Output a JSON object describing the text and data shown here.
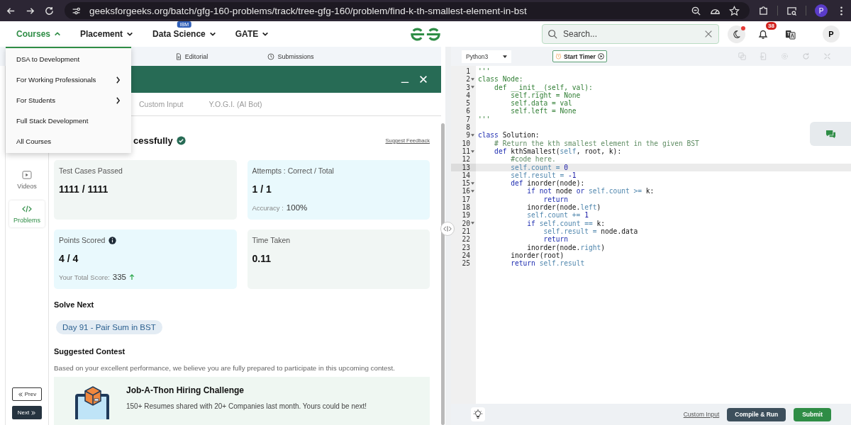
{
  "browser": {
    "url": "geeksforgeeks.org/batch/gfg-160-problems/track/tree-gfg-160/problem/find-k-th-smallest-element-in-bst",
    "profile": "P"
  },
  "nav": {
    "items": [
      {
        "label": "Courses",
        "selected": true
      },
      {
        "label": "Placement",
        "selected": false
      },
      {
        "label": "Data Science",
        "selected": false,
        "badge": "IBM"
      },
      {
        "label": "GATE",
        "selected": false
      }
    ],
    "search": {
      "placeholder": "Search..."
    },
    "theme_alert": true,
    "notifications": "38",
    "avatar": "P"
  },
  "courses_menu": [
    {
      "label": "DSA to Development",
      "submenu": false
    },
    {
      "label": "For Working Professionals",
      "submenu": true
    },
    {
      "label": "For Students",
      "submenu": true
    },
    {
      "label": "Full Stack Development",
      "submenu": false
    },
    {
      "label": "All Courses",
      "submenu": false
    }
  ],
  "problem_tabs": [
    {
      "label": "Editorial",
      "kind": "document",
      "selected": false
    },
    {
      "label": "Submissions",
      "kind": "clock",
      "selected": false
    }
  ],
  "sidebar": {
    "items": [
      {
        "label": "Videos",
        "kind": "video",
        "selected": false
      },
      {
        "label": "Problems",
        "kind": "code",
        "selected": true
      }
    ],
    "prev": "Prev",
    "next": "Next"
  },
  "result": {
    "tabs": [
      {
        "label": "Custom Input",
        "selected": false
      },
      {
        "label": "Y.O.G.I. (AI Bot)",
        "selected": false
      }
    ],
    "heading": "cessfully",
    "feedback": "Suggest Feedback",
    "cards": [
      {
        "label": "Test Cases Passed",
        "value": "1111 / 1111",
        "color": "#f1f6f4",
        "info": false
      },
      {
        "label": "Attempts : Correct / Total",
        "value": "1 / 1",
        "color": "#e9f9fd",
        "info": false,
        "sub_label": "Accuracy :",
        "sub_value": "100%",
        "trend_up": false
      },
      {
        "label": "Points Scored",
        "info": true,
        "value": "4 / 4",
        "color": "#e9f9fd",
        "sub_label": "Your Total Score:",
        "sub_value": "335",
        "trend_up": true
      },
      {
        "label": "Time Taken",
        "value": "0.11",
        "color": "#f1f6f4",
        "info": false
      }
    ],
    "solve_next": {
      "title": "Solve Next",
      "items": [
        "Day 91 - Pair Sum in BST"
      ]
    },
    "contest": {
      "title": "Suggested Contest",
      "description": "Based on your excellent performance, we believe you are fully prepared to participate in this upcoming contest.",
      "name": "Job-A-Thon Hiring Challenge",
      "tagline": "150+ Resumes shared with 20+ Companies last month. Yours could be next!"
    }
  },
  "editor": {
    "language": "Python3",
    "timer": "Start Timer",
    "custom_input": "Custom Input",
    "run": "Compile & Run",
    "submit": "Submit",
    "lines": [
      {
        "n": "1",
        "fold": false,
        "selected": false,
        "tokens": [
          {
            "kind": "str",
            "t": "'''"
          }
        ]
      },
      {
        "n": "2",
        "fold": true,
        "selected": false,
        "tokens": [
          {
            "kind": "str",
            "t": "class Node:"
          }
        ]
      },
      {
        "n": "3",
        "fold": true,
        "selected": false,
        "tokens": [
          {
            "kind": "str",
            "t": "    def __init__(self, val):"
          }
        ]
      },
      {
        "n": "4",
        "fold": false,
        "selected": false,
        "tokens": [
          {
            "kind": "str",
            "t": "        self.right = None"
          }
        ]
      },
      {
        "n": "5",
        "fold": false,
        "selected": false,
        "tokens": [
          {
            "kind": "str",
            "t": "        self.data = val"
          }
        ]
      },
      {
        "n": "6",
        "fold": false,
        "selected": false,
        "tokens": [
          {
            "kind": "str",
            "t": "        self.left = None"
          }
        ]
      },
      {
        "n": "7",
        "fold": false,
        "selected": false,
        "tokens": [
          {
            "kind": "str",
            "t": "'''"
          }
        ]
      },
      {
        "n": "8",
        "fold": false,
        "selected": false
      },
      {
        "n": "9",
        "fold": true,
        "selected": false,
        "tokens": [
          {
            "kind": "kw",
            "t": "class"
          },
          {
            "kind": "plain",
            "t": " Solution:"
          }
        ]
      },
      {
        "n": "10",
        "fold": false,
        "selected": false,
        "tokens": [
          {
            "kind": "comment",
            "t": "    # Return the kth smallest element in the given BST"
          }
        ]
      },
      {
        "n": "11",
        "fold": true,
        "selected": false,
        "tokens": [
          {
            "kind": "kw",
            "t": "    def"
          },
          {
            "kind": "plain",
            "t": " kthSmallest("
          },
          {
            "kind": "self",
            "t": "self"
          },
          {
            "kind": "plain",
            "t": ", root, k):"
          }
        ]
      },
      {
        "n": "12",
        "fold": false,
        "selected": false,
        "tokens": [
          {
            "kind": "comment",
            "t": "        #code here."
          }
        ]
      },
      {
        "n": "13",
        "fold": false,
        "selected": true,
        "tokens": [
          {
            "kind": "self",
            "t": "        self.count = "
          },
          {
            "kind": "num",
            "t": "0"
          }
        ]
      },
      {
        "n": "14",
        "fold": false,
        "selected": false,
        "tokens": [
          {
            "kind": "self",
            "t": "        self.result = "
          },
          {
            "kind": "num",
            "t": "-1"
          }
        ]
      },
      {
        "n": "15",
        "fold": true,
        "selected": false,
        "tokens": [
          {
            "kind": "kw",
            "t": "        def"
          },
          {
            "kind": "plain",
            "t": " inorder(node):"
          }
        ]
      },
      {
        "n": "16",
        "fold": true,
        "selected": false,
        "tokens": [
          {
            "kind": "kw",
            "t": "            if not"
          },
          {
            "kind": "plain",
            "t": " node "
          },
          {
            "kind": "kw",
            "t": "or"
          },
          {
            "kind": "self",
            "t": " self.count >= "
          },
          {
            "kind": "plain",
            "t": "k:"
          }
        ]
      },
      {
        "n": "17",
        "fold": false,
        "selected": false,
        "tokens": [
          {
            "kind": "kw",
            "t": "                return"
          }
        ]
      },
      {
        "n": "18",
        "fold": false,
        "selected": false,
        "tokens": [
          {
            "kind": "plain",
            "t": "            inorder(node."
          },
          {
            "kind": "self",
            "t": "left"
          },
          {
            "kind": "plain",
            "t": ")"
          }
        ]
      },
      {
        "n": "19",
        "fold": false,
        "selected": false,
        "tokens": [
          {
            "kind": "self",
            "t": "            self.count += "
          },
          {
            "kind": "num",
            "t": "1"
          }
        ]
      },
      {
        "n": "20",
        "fold": true,
        "selected": false,
        "tokens": [
          {
            "kind": "kw",
            "t": "            if"
          },
          {
            "kind": "self",
            "t": " self.count == "
          },
          {
            "kind": "plain",
            "t": "k:"
          }
        ]
      },
      {
        "n": "21",
        "fold": false,
        "selected": false,
        "tokens": [
          {
            "kind": "self",
            "t": "                self.result = "
          },
          {
            "kind": "plain",
            "t": "node.data"
          }
        ]
      },
      {
        "n": "22",
        "fold": false,
        "selected": false,
        "tokens": [
          {
            "kind": "kw",
            "t": "                return"
          }
        ]
      },
      {
        "n": "23",
        "fold": false,
        "selected": false,
        "tokens": [
          {
            "kind": "plain",
            "t": "            inorder(node."
          },
          {
            "kind": "self",
            "t": "right"
          },
          {
            "kind": "plain",
            "t": ")"
          }
        ]
      },
      {
        "n": "24",
        "fold": false,
        "selected": false,
        "tokens": [
          {
            "kind": "plain",
            "t": "        inorder(root)"
          }
        ]
      },
      {
        "n": "25",
        "fold": false,
        "selected": false,
        "tokens": [
          {
            "kind": "kw",
            "t": "        return"
          },
          {
            "kind": "self",
            "t": " self.result"
          }
        ]
      }
    ]
  }
}
